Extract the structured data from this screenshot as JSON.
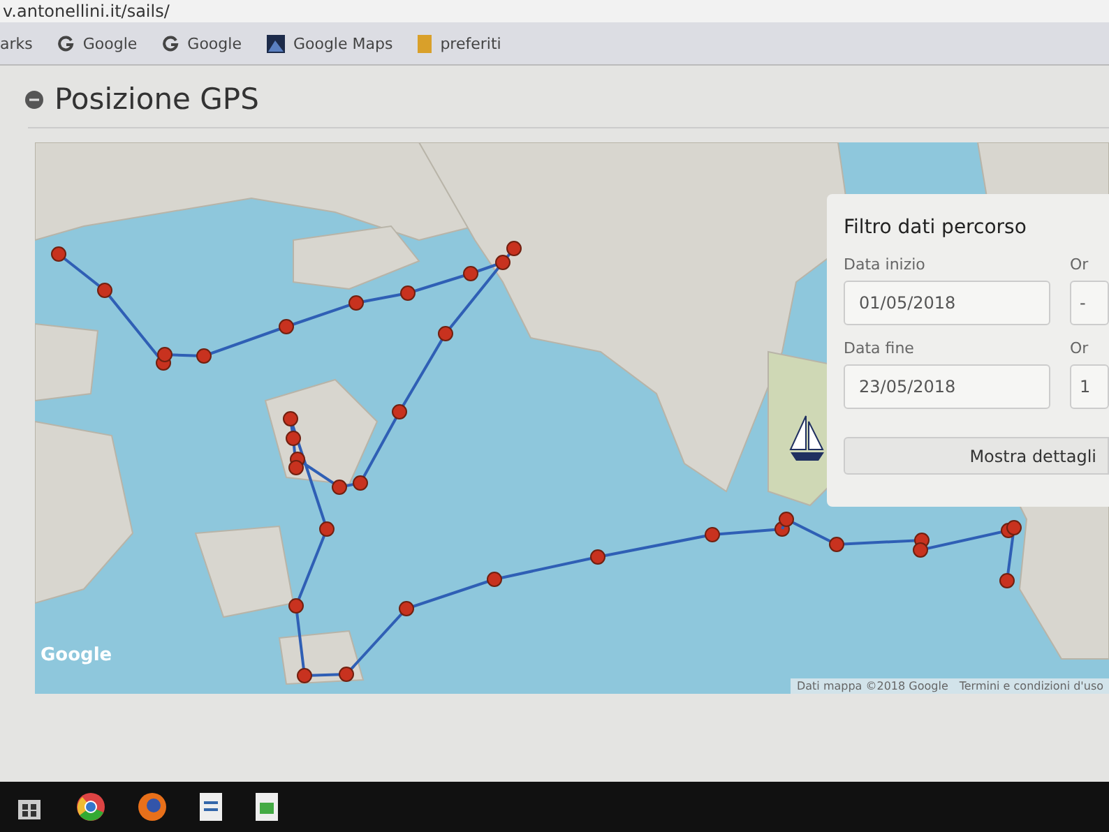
{
  "address_bar": {
    "url": "v.antonellini.it/sails/"
  },
  "bookmarks": [
    {
      "kind": "text",
      "label": "arks"
    },
    {
      "kind": "google",
      "label": "Google"
    },
    {
      "kind": "google",
      "label": "Google"
    },
    {
      "kind": "maps",
      "label": "Google Maps"
    },
    {
      "kind": "folder",
      "label": "preferiti"
    }
  ],
  "page": {
    "title": "Posizione GPS"
  },
  "map": {
    "logo": "Google",
    "attribution": "Dati mappa ©2018 Google",
    "terms": "Termini e condizioni d'uso"
  },
  "filter_panel": {
    "title": "Filtro dati percorso",
    "rows": [
      {
        "date_label": "Data inizio",
        "date_value": "01/05/2018",
        "time_label": "Or",
        "time_value": "-"
      },
      {
        "date_label": "Data fine",
        "date_value": "23/05/2018",
        "time_label": "Or",
        "time_value": "1"
      }
    ],
    "button": "Mostra dettagli"
  }
}
